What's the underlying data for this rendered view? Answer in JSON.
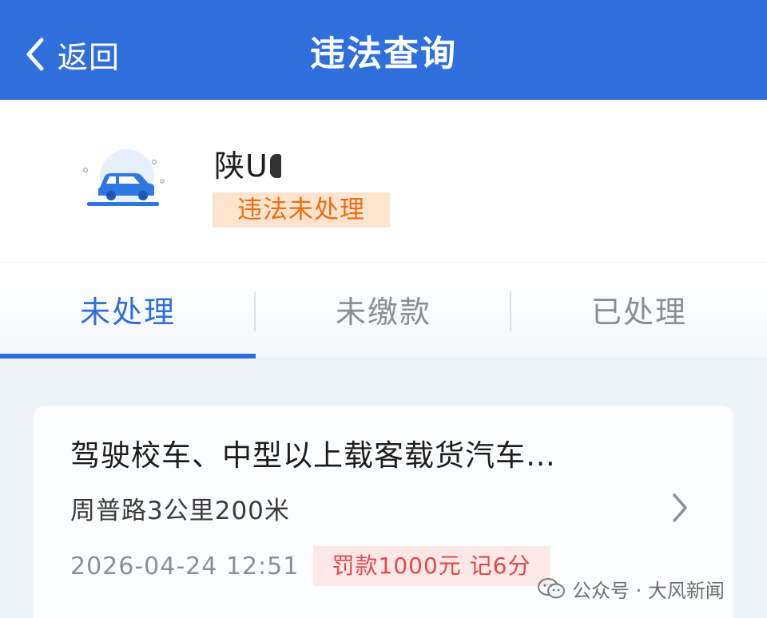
{
  "header": {
    "back_label": "返回",
    "title": "违法查询",
    "color": "#2f6fdb"
  },
  "vehicle": {
    "plate": "陕U",
    "status_badge": "违法未处理",
    "icon": "car-icon"
  },
  "tabs": [
    {
      "label": "未处理",
      "active": true
    },
    {
      "label": "未缴款",
      "active": false
    },
    {
      "label": "已处理",
      "active": false
    }
  ],
  "violation": {
    "title": "驾驶校车、中型以上载客载货汽车…",
    "location": "周普路3公里200米",
    "time": "2026-04-24 12:51",
    "penalty": "罚款1000元 记6分"
  },
  "watermark": {
    "text": "公众号 · 大风新闻",
    "icon": "wechat-icon"
  },
  "colors": {
    "accent": "#2f6fdb",
    "badge_text": "#ef6c10",
    "badge_bg": "#fde4cf",
    "fine_text": "#e24949",
    "fine_bg": "#fde8e8"
  }
}
